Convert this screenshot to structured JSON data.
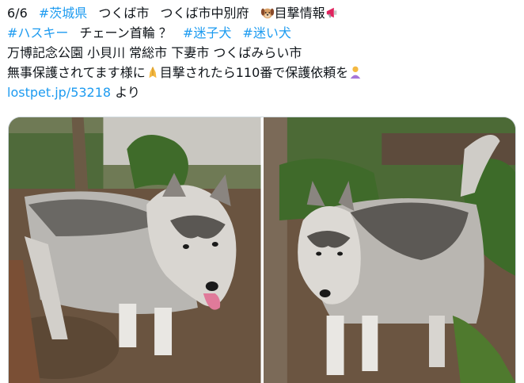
{
  "post": {
    "line1": {
      "date": "6/6",
      "tag_ibaraki": "#茨城県",
      "city": "つくば市",
      "area": "つくば市中別府",
      "dog_icon": "dog-face-emoji",
      "sighting": "目撃情報",
      "megaphone_icon": "megaphone-emoji"
    },
    "line2": {
      "tag_husky": "#ハスキー",
      "collar": "チェーン首輪 ？",
      "tag_lost_dog": "#迷子犬",
      "tag_stray_dog": "#迷い犬"
    },
    "line3": {
      "places": "万博記念公園 小貝川 常総市 下妻市 つくばみらい市"
    },
    "line4": {
      "protected": "無事保護されてます様に",
      "pray_icon": "folded-hands-emoji",
      "request": "目撃されたら110番で保護依頼を",
      "bow_icon": "person-bowing-emoji"
    },
    "line5": {
      "link": "lostpet.jp/53218",
      "suffix": "より"
    }
  },
  "media": {
    "photos": [
      {
        "subject": "husky-photo-left"
      },
      {
        "subject": "husky-photo-right"
      }
    ]
  }
}
